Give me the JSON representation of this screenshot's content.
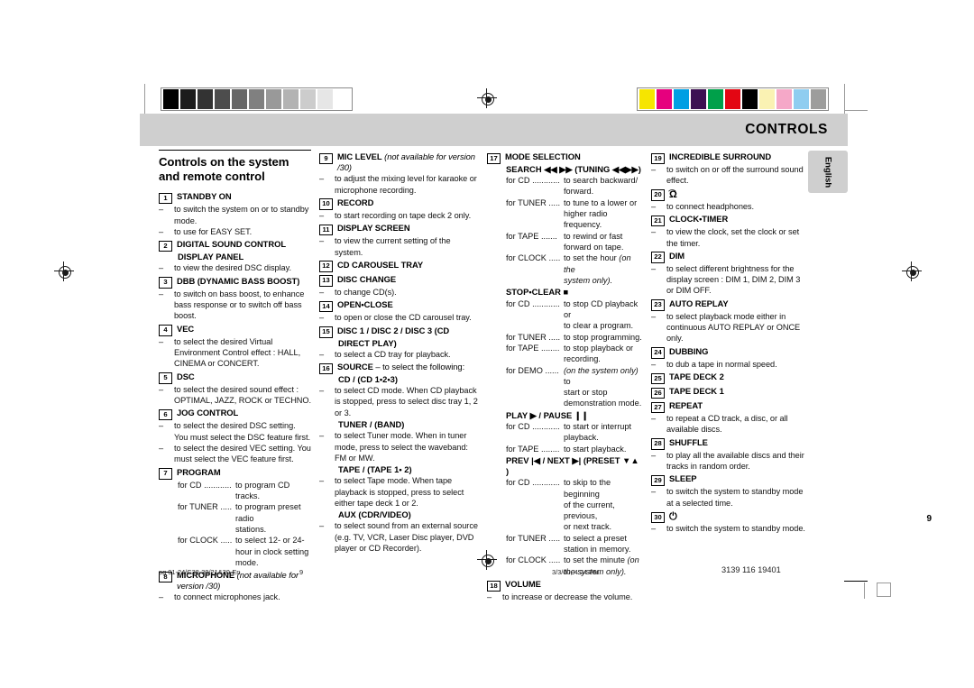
{
  "header": {
    "title": "CONTROLS",
    "language_tab": "English",
    "page_number": "9"
  },
  "calibration": {
    "grayscale": [
      "#000000",
      "#1c1c1c",
      "#333333",
      "#4d4d4d",
      "#666666",
      "#808080",
      "#999999",
      "#b3b3b3",
      "#cccccc",
      "#e6e6e6",
      "#ffffff"
    ],
    "colorbar": [
      "#f6e500",
      "#e6007e",
      "#009fe3",
      "#3d1152",
      "#00a04a",
      "#e30613",
      "#000000",
      "#faf2b3",
      "#f5a8c8",
      "#8fcdf0",
      "#9d9d9c"
    ]
  },
  "footer": {
    "file": "pg 01-24/C38-39/21&30-En",
    "page": "9",
    "date": "3/3/00, 4:24 PM",
    "code": "3139 116 19401"
  },
  "columns": [
    {
      "id": "col-1",
      "section_title": "Controls on the system and remote control",
      "items": [
        {
          "num": "1",
          "title": "STANDBY ON",
          "lines": [
            {
              "type": "dash",
              "text": "to switch the system on or to standby mode."
            },
            {
              "type": "dash",
              "text": "to use for EASY SET."
            }
          ]
        },
        {
          "num": "2",
          "title": "DIGITAL SOUND CONTROL",
          "title2": "DISPLAY PANEL",
          "lines": [
            {
              "type": "dash",
              "text": "to view the desired DSC display."
            }
          ]
        },
        {
          "num": "3",
          "title": "DBB (DYNAMIC BASS BOOST)",
          "lines": [
            {
              "type": "dash",
              "text": "to switch on bass boost, to enhance bass response or to switch off bass boost."
            }
          ]
        },
        {
          "num": "4",
          "title": "VEC",
          "lines": [
            {
              "type": "dash",
              "text": "to select the desired Virtual Environment Control effect : HALL, CINEMA or CONCERT."
            }
          ]
        },
        {
          "num": "5",
          "title": "DSC",
          "lines": [
            {
              "type": "dash",
              "text": "to select the desired sound effect : OPTIMAL, JAZZ,  ROCK or TECHNO."
            }
          ]
        },
        {
          "num": "6",
          "title": "JOG CONTROL",
          "lines": [
            {
              "type": "dash",
              "text": "to select the desired DSC setting. You must select the DSC feature first."
            },
            {
              "type": "dash",
              "text": "to select the desired VEC setting. You must select the VEC feature first."
            }
          ]
        },
        {
          "num": "7",
          "title": "PROGRAM",
          "lines": [
            {
              "type": "for",
              "key": "for CD ............",
              "value": "to program CD tracks."
            },
            {
              "type": "for",
              "key": "for TUNER .....",
              "value": "to program preset radio"
            },
            {
              "type": "cont",
              "text": "stations."
            },
            {
              "type": "for",
              "key": "for CLOCK .....",
              "value": "to select 12- or 24-"
            },
            {
              "type": "cont",
              "text": "hour in clock setting"
            },
            {
              "type": "cont",
              "text": "mode."
            }
          ]
        },
        {
          "num": "8",
          "title": "MICROPHONE",
          "title_italic": "(not available for version /30)",
          "lines": [
            {
              "type": "dash",
              "text": "to connect microphones jack."
            }
          ]
        }
      ]
    },
    {
      "id": "col-2",
      "items": [
        {
          "num": "9",
          "title": "MIC LEVEL",
          "title_italic": "(not available for version /30)",
          "lines": [
            {
              "type": "dash",
              "text": "to adjust the mixing level for karaoke or microphone recording."
            }
          ]
        },
        {
          "num": "10",
          "title": "RECORD",
          "lines": [
            {
              "type": "dash",
              "text": "to start recording on tape deck 2 only."
            }
          ]
        },
        {
          "num": "11",
          "title": "DISPLAY SCREEN",
          "lines": [
            {
              "type": "dash",
              "text": "to view the current setting of the system."
            }
          ]
        },
        {
          "num": "12",
          "title": "CD CAROUSEL TRAY",
          "lines": []
        },
        {
          "num": "13",
          "title": "DISC CHANGE",
          "lines": [
            {
              "type": "dash",
              "text": "to change CD(s)."
            }
          ]
        },
        {
          "num": "14",
          "title": "OPEN•CLOSE",
          "lines": [
            {
              "type": "dash",
              "text": "to open or close the CD carousel tray."
            }
          ]
        },
        {
          "num": "15",
          "title": "DISC 1 / DISC 2 / DISC 3 (CD",
          "title2": "DIRECT PLAY)",
          "lines": [
            {
              "type": "dash",
              "text": "to select a CD tray for playback."
            }
          ]
        },
        {
          "num": "16",
          "title": "SOURCE",
          "title_plain": " – to select the following:",
          "title2": "CD / (CD 1•2•3)",
          "lines": [
            {
              "type": "dash",
              "text": "to select CD mode. When CD playback is stopped, press to select disc tray 1, 2 or 3."
            },
            {
              "type": "sub",
              "text": "TUNER / (BAND)"
            },
            {
              "type": "dash",
              "text": "to select Tuner mode. When in tuner mode, press to select the waveband: FM or MW."
            },
            {
              "type": "sub",
              "text": "TAPE / (TAPE 1• 2)"
            },
            {
              "type": "dash",
              "text": "to select Tape mode. When tape playback is stopped, press to select either tape deck 1 or 2."
            },
            {
              "type": "sub",
              "text": "AUX  (CDR/VIDEO)"
            },
            {
              "type": "dash",
              "text": "to select sound from an external source (e.g. TV, VCR, Laser Disc player, DVD player or CD Recorder)."
            }
          ]
        }
      ]
    },
    {
      "id": "col-3",
      "items": [
        {
          "num": "17",
          "title": "MODE SELECTION",
          "title2": "SEARCH ◀◀ ▶▶ (TUNING  ◀◀▶▶)",
          "lines": [
            {
              "type": "for",
              "key": "for CD ............",
              "value": "to search backward/"
            },
            {
              "type": "cont",
              "text": "forward."
            },
            {
              "type": "for",
              "key": "for TUNER .....",
              "value": "to tune to a lower or"
            },
            {
              "type": "cont",
              "text": "higher radio frequency."
            },
            {
              "type": "for",
              "key": " for TAPE .......",
              "value": "to rewind or fast"
            },
            {
              "type": "cont",
              "text": "forward on tape."
            },
            {
              "type": "for",
              "key": "for CLOCK .....",
              "value": "to set the hour (on the",
              "italic_tail": "(on the"
            },
            {
              "type": "cont-i",
              "text": "system only)."
            },
            {
              "type": "sub",
              "text": "STOP•CLEAR ■"
            },
            {
              "type": "for",
              "key": "for CD ............",
              "value": "to stop CD playback or"
            },
            {
              "type": "cont",
              "text": "to clear a program."
            },
            {
              "type": "for",
              "key": "for TUNER .....",
              "value": "to stop programming."
            },
            {
              "type": "for",
              "key": "for TAPE ........",
              "value": "to stop playback or"
            },
            {
              "type": "cont",
              "text": "recording."
            },
            {
              "type": "for-i",
              "key": "for DEMO ......",
              "value": "(on the system only) to",
              "italic_head": "(on the system only)"
            },
            {
              "type": "cont",
              "text": "start or stop"
            },
            {
              "type": "cont",
              "text": "demonstration mode."
            },
            {
              "type": "sub",
              "text": "PLAY ▶ / PAUSE ❙❙"
            },
            {
              "type": "for",
              "key": "for CD ............",
              "value": "to start or interrupt"
            },
            {
              "type": "cont",
              "text": "playback."
            },
            {
              "type": "for",
              "key": "for TAPE ........",
              "value": "to start playback."
            },
            {
              "type": "sub",
              "text": "PREV |◀  / NEXT ▶| (PRESET ▼▲ )"
            },
            {
              "type": "for",
              "key": "for CD ............",
              "value": "to skip to the beginning"
            },
            {
              "type": "cont",
              "text": "of the current, previous,"
            },
            {
              "type": "cont",
              "text": "or next track."
            },
            {
              "type": "for",
              "key": "for TUNER .....",
              "value": "to select a preset"
            },
            {
              "type": "cont",
              "text": "station in memory."
            },
            {
              "type": "for",
              "key": "for CLOCK .....",
              "value": "to set the minute (on",
              "italic_tail": "(on"
            },
            {
              "type": "cont-i",
              "text": "the system only)."
            }
          ]
        },
        {
          "num": "18",
          "title": "VOLUME",
          "lines": [
            {
              "type": "dash",
              "text": "to increase or decrease the volume."
            }
          ]
        }
      ]
    },
    {
      "id": "col-4",
      "items": [
        {
          "num": "19",
          "title": "INCREDIBLE SURROUND",
          "lines": [
            {
              "type": "dash",
              "text": "to switch on or off the surround sound effect."
            }
          ]
        },
        {
          "num": "20",
          "title": "headphones-icon",
          "title_is_icon": true,
          "lines": [
            {
              "type": "dash",
              "text": "to connect headphones."
            }
          ]
        },
        {
          "num": "21",
          "title": "CLOCK•TIMER",
          "lines": [
            {
              "type": "dash",
              "text": "to view the clock, set the clock or set the timer."
            }
          ]
        },
        {
          "num": "22",
          "title": "DIM",
          "lines": [
            {
              "type": "dash",
              "text": "to select different brightness for the display screen : DIM 1, DIM 2, DIM 3 or DIM OFF."
            }
          ]
        },
        {
          "num": "23",
          "title": "AUTO REPLAY",
          "lines": [
            {
              "type": "dash",
              "text": "to select playback mode either in continuous AUTO REPLAY or ONCE only."
            }
          ]
        },
        {
          "num": "24",
          "title": "DUBBING",
          "lines": [
            {
              "type": "dash",
              "text": "to dub a tape in normal speed."
            }
          ]
        },
        {
          "num": "25",
          "title": "TAPE DECK 2",
          "lines": []
        },
        {
          "num": "26",
          "title": "TAPE DECK 1",
          "lines": []
        },
        {
          "num": "27",
          "title": "REPEAT",
          "lines": [
            {
              "type": "dash",
              "text": "to repeat a CD track, a disc, or all available discs."
            }
          ]
        },
        {
          "num": "28",
          "title": "SHUFFLE",
          "lines": [
            {
              "type": "dash",
              "text": "to play all the available discs and their tracks in random order."
            }
          ]
        },
        {
          "num": "29",
          "title": "SLEEP",
          "lines": [
            {
              "type": "dash",
              "text": "to switch the system to standby mode at a selected time."
            }
          ]
        },
        {
          "num": "30",
          "title": "standby-power-icon",
          "title_is_icon": true,
          "lines": [
            {
              "type": "dash",
              "text": "to switch the system to standby mode."
            }
          ]
        }
      ]
    }
  ]
}
